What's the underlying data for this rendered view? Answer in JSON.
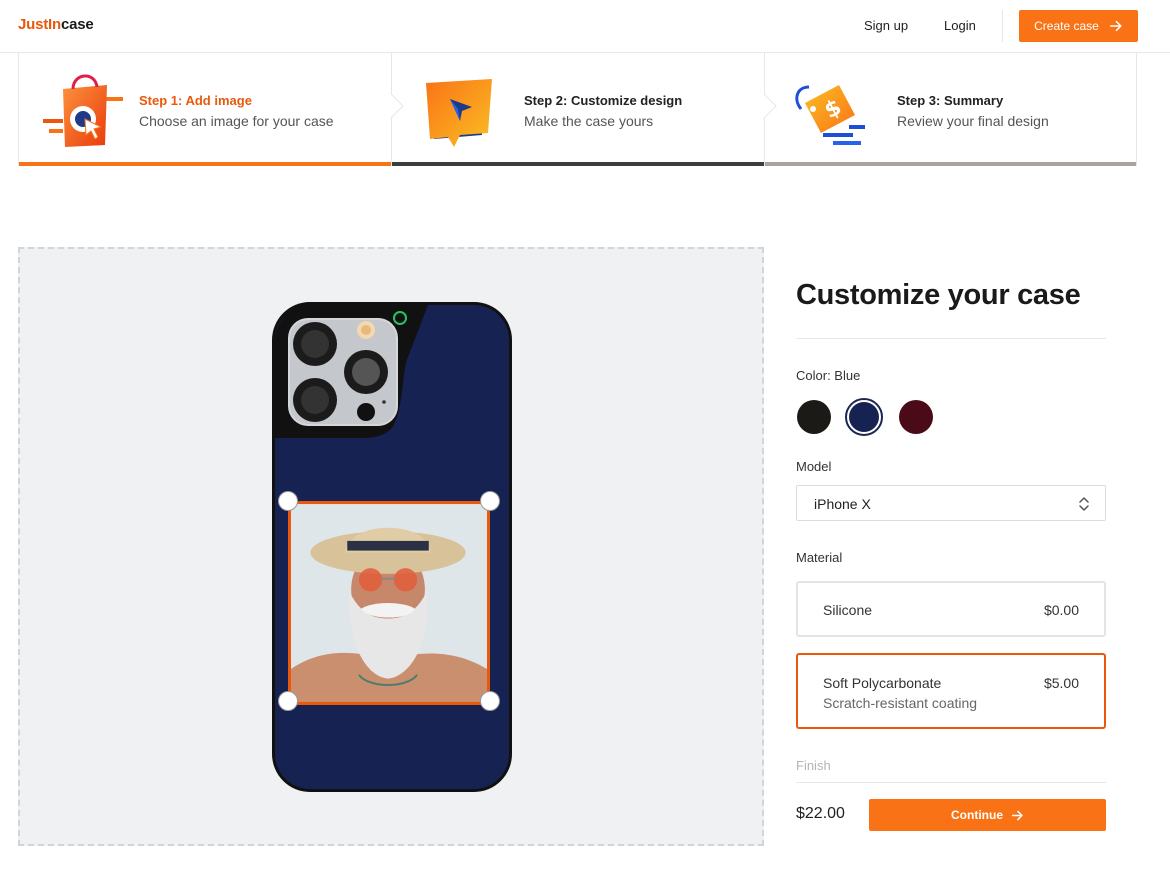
{
  "header": {
    "logo_part1": "JustIn",
    "logo_part2": "case",
    "signup": "Sign up",
    "login": "Login",
    "create": "Create case"
  },
  "steps": [
    {
      "title": "Step 1: Add image",
      "desc": "Choose an image for your case",
      "icon": "shopping-bag-cursor-icon"
    },
    {
      "title": "Step 2: Customize design",
      "desc": "Make the case yours",
      "icon": "design-cursor-icon"
    },
    {
      "title": "Step 3: Summary",
      "desc": "Review your final design",
      "icon": "price-tag-icon"
    }
  ],
  "panel": {
    "title": "Customize your case",
    "color_label": "Color: Blue",
    "colors": [
      {
        "name": "Black",
        "hex": "#1c1a17"
      },
      {
        "name": "Blue",
        "hex": "#162252",
        "selected": true
      },
      {
        "name": "Maroon",
        "hex": "#4b0a18"
      }
    ],
    "model_label": "Model",
    "model_value": "iPhone X",
    "material_label": "Material",
    "materials": [
      {
        "name": "Silicone",
        "price": "$0.00",
        "note": ""
      },
      {
        "name": "Soft Polycarbonate",
        "price": "$5.00",
        "note": "Scratch-resistant coating",
        "selected": true
      }
    ],
    "finish_label": "Finish",
    "total": "$22.00",
    "continue": "Continue"
  },
  "colors": {
    "accent": "#f97316",
    "case_blue": "#162252"
  }
}
